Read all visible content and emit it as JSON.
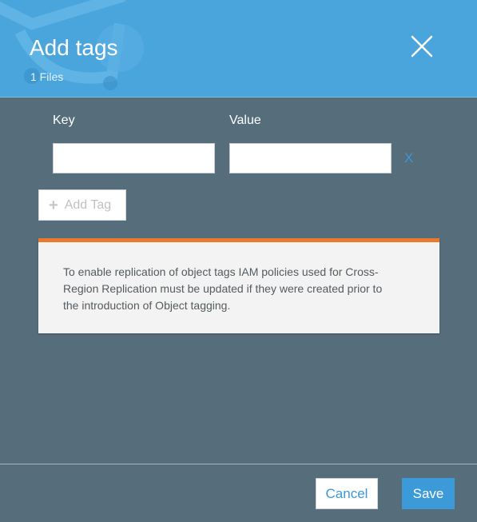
{
  "dialog": {
    "title": "Add tags",
    "subtitle": "1 Files",
    "close_icon": "close-icon"
  },
  "tags": {
    "key_label": "Key",
    "value_label": "Value",
    "rows": [
      {
        "key": "",
        "value": "",
        "remove_label": "X"
      }
    ],
    "add_tag_label": "Add Tag",
    "add_icon": "plus-icon"
  },
  "notice": {
    "text": "To enable replication of object tags IAM policies used for Cross-Region Replication must be updated if they were created prior to the introduction of Object tagging.",
    "accent_color": "#ea7a2b"
  },
  "footer": {
    "cancel_label": "Cancel",
    "save_label": "Save"
  },
  "colors": {
    "header": "#4aa5dc",
    "body": "#566d7b",
    "primary": "#3c9ad9"
  }
}
